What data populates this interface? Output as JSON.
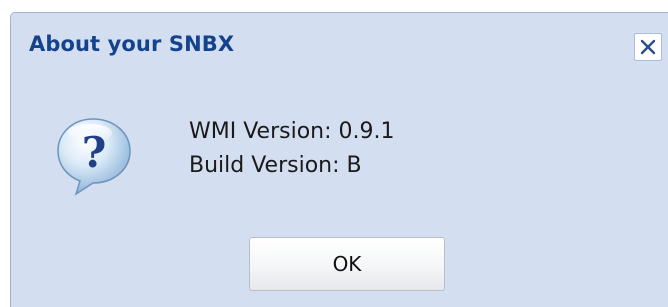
{
  "dialog": {
    "title": "About your SNBX",
    "close_icon": "close-icon",
    "message_icon": "question-icon",
    "lines": [
      "WMI Version: 0.9.1",
      "Build Version: B"
    ],
    "ok_label": "OK"
  },
  "colors": {
    "dialog_background": "#d3dff0",
    "title_text": "#15428b",
    "border": "#9fb3cf"
  }
}
